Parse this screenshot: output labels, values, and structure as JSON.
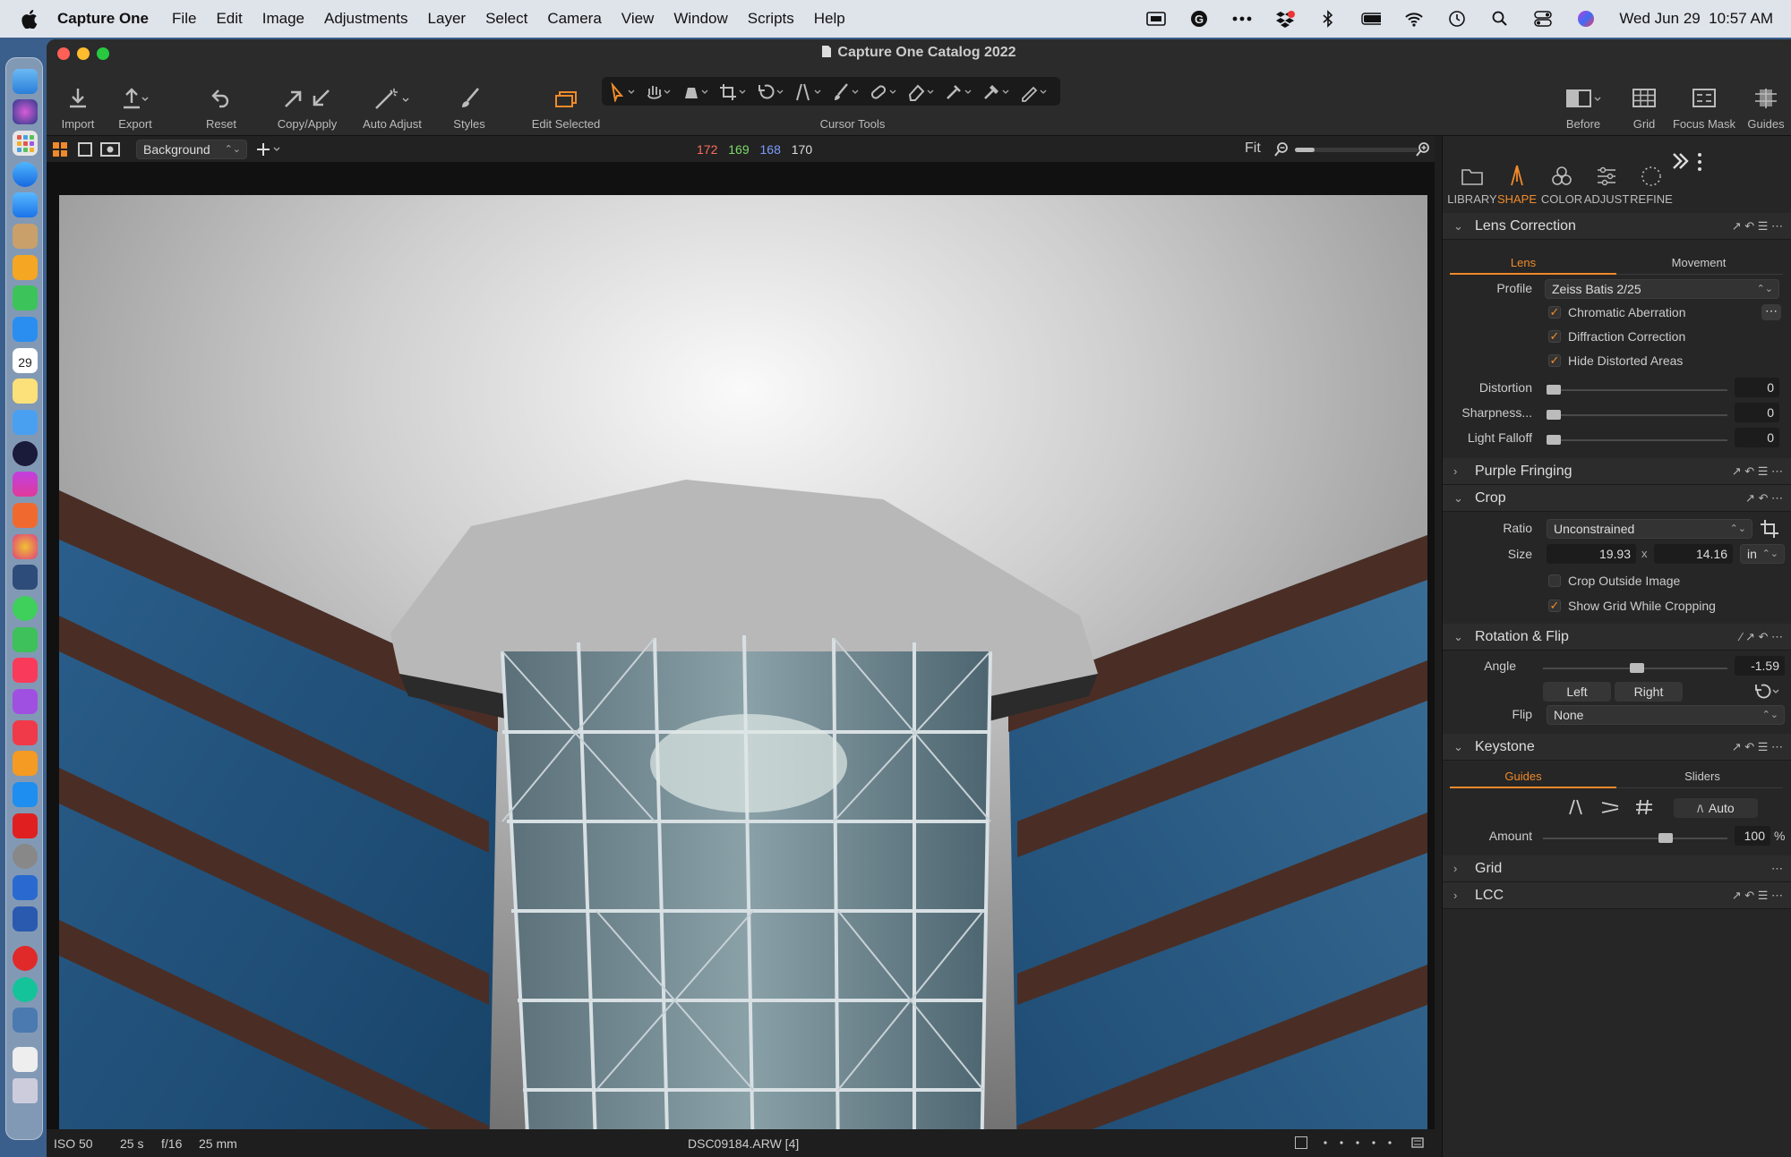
{
  "menubar": {
    "app_name": "Capture One",
    "items": [
      "File",
      "Edit",
      "Image",
      "Adjustments",
      "Layer",
      "Select",
      "Camera",
      "View",
      "Window",
      "Scripts",
      "Help"
    ],
    "datetime": "Wed Jun 29  10:57 AM"
  },
  "dock": {
    "calendar_day": "29"
  },
  "window": {
    "title": "Capture One Catalog 2022"
  },
  "toolbar": {
    "import": "Import",
    "export": "Export",
    "reset": "Reset",
    "copy_apply": "Copy/Apply",
    "auto_adjust": "Auto Adjust",
    "styles": "Styles",
    "edit_selected": "Edit Selected",
    "cursor_tools": "Cursor Tools",
    "before": "Before",
    "grid": "Grid",
    "focus_mask": "Focus Mask",
    "guides": "Guides"
  },
  "viewerbar": {
    "layer": "Background",
    "readout_r": "172",
    "readout_g": "169",
    "readout_b": "168",
    "readout_l": "170",
    "zoom": "Fit"
  },
  "statusbar": {
    "iso": "ISO 50",
    "shutter": "25 s",
    "aperture": "f/16",
    "focal": "25 mm",
    "filename": "DSC09184.ARW [4]"
  },
  "panel": {
    "tabs": [
      "LIBRARY",
      "SHAPE",
      "COLOR",
      "ADJUST",
      "REFINE"
    ],
    "lens": {
      "title": "Lens Correction",
      "subtab_lens": "Lens",
      "subtab_movement": "Movement",
      "profile_label": "Profile",
      "profile_value": "Zeiss Batis 2/25",
      "chromatic": "Chromatic Aberration",
      "diffraction": "Diffraction Correction",
      "hide_distorted": "Hide Distorted Areas",
      "distortion_label": "Distortion",
      "distortion_value": "0",
      "sharpness_label": "Sharpness...",
      "sharpness_value": "0",
      "falloff_label": "Light Falloff",
      "falloff_value": "0"
    },
    "purple": {
      "title": "Purple Fringing"
    },
    "crop": {
      "title": "Crop",
      "ratio_label": "Ratio",
      "ratio_value": "Unconstrained",
      "size_label": "Size",
      "width": "19.93",
      "x": "x",
      "height": "14.16",
      "unit": "in",
      "crop_outside": "Crop Outside Image",
      "show_grid": "Show Grid While Cropping"
    },
    "rotation": {
      "title": "Rotation & Flip",
      "angle_label": "Angle",
      "angle_value": "-1.59",
      "angle_fraction": 0.51,
      "left": "Left",
      "right": "Right",
      "flip_label": "Flip",
      "flip_value": "None"
    },
    "keystone": {
      "title": "Keystone",
      "subtab_guides": "Guides",
      "subtab_sliders": "Sliders",
      "auto": "Auto",
      "amount_label": "Amount",
      "amount_value": "100",
      "amount_unit": "%",
      "amount_fraction": 0.68
    },
    "grid": {
      "title": "Grid"
    },
    "lcc": {
      "title": "LCC"
    }
  },
  "colors": {
    "accent": "#f08a2a",
    "red_readout": "#ff6b5a",
    "green_readout": "#7ddc6a",
    "blue_readout": "#7a9cff"
  }
}
